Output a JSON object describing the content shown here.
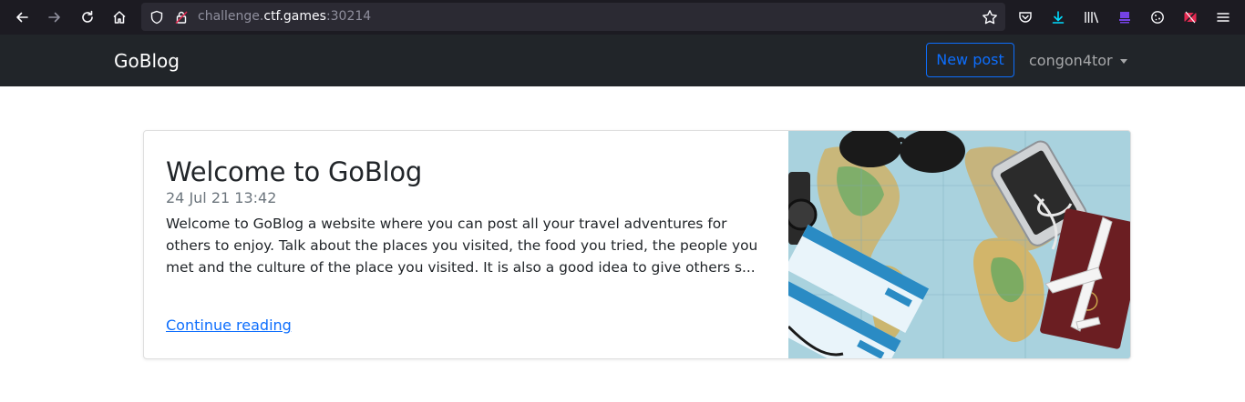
{
  "browser": {
    "url_prefix": "challenge.",
    "url_host": "ctf.games",
    "url_suffix": ":30214",
    "icons": [
      "back-icon",
      "forward-icon",
      "reload-icon",
      "home-icon",
      "shield-icon",
      "lock-icon",
      "star-icon",
      "pocket-icon",
      "download-icon",
      "library-icon",
      "extension-icon",
      "cookie-icon",
      "blocked-icon",
      "menu-icon"
    ]
  },
  "navbar": {
    "brand": "GoBlog",
    "new_post_label": "New post",
    "username": "congon4tor"
  },
  "post": {
    "title": "Welcome to GoBlog",
    "date": "24 Jul 21 13:42",
    "excerpt": "Welcome to GoBlog a website where you can post all your travel adventures for others to enjoy. Talk about the places you visited, the food you tried, the people you met and the culture of the place you visited. It is also a good idea to give others s...",
    "continue_label": "Continue reading"
  },
  "colors": {
    "browser_bg": "#1c1b22",
    "urlbar_bg": "#2b2a33",
    "navbar_bg": "#212529",
    "accent": "#0d6efd"
  }
}
